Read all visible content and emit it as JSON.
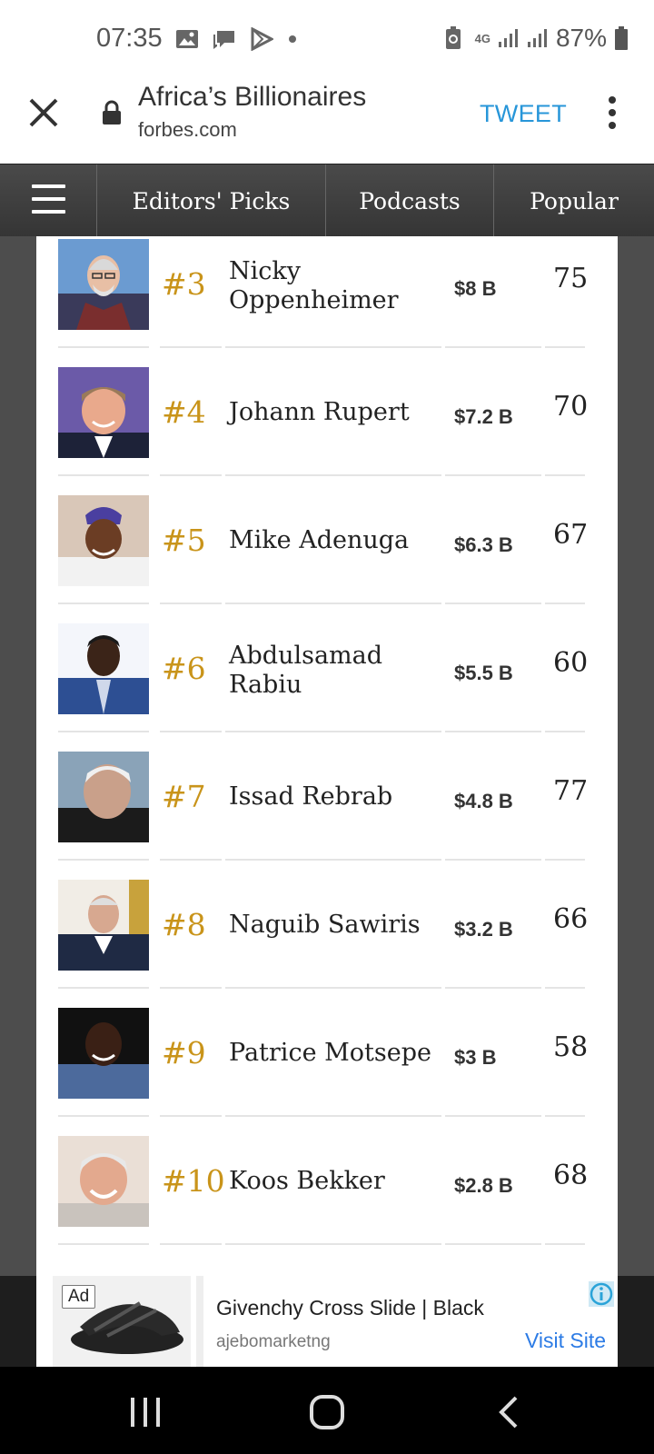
{
  "status_bar": {
    "time": "07:35",
    "network": "4G",
    "battery_percent": "87%",
    "left_icons": [
      "gallery-icon",
      "messages-icon",
      "play-store-icon",
      "dot-icon"
    ],
    "right_icons": [
      "battery-saver-icon",
      "network-4g-icon",
      "signal-icon",
      "signal-icon",
      "battery-icon"
    ]
  },
  "tab_header": {
    "title": "Africa’s Billionaires",
    "url": "forbes.com",
    "action_label": "TWEET"
  },
  "nav": {
    "items": [
      {
        "label": "Editors' Picks"
      },
      {
        "label": "Podcasts"
      },
      {
        "label": "Popular"
      }
    ]
  },
  "billionaires": [
    {
      "rank": "#3",
      "name": "Nicky Oppenheimer",
      "net_worth": "$8 B",
      "age": "75"
    },
    {
      "rank": "#4",
      "name": "Johann Rupert",
      "net_worth": "$7.2 B",
      "age": "70"
    },
    {
      "rank": "#5",
      "name": "Mike Adenuga",
      "net_worth": "$6.3 B",
      "age": "67"
    },
    {
      "rank": "#6",
      "name": "Abdulsamad Rabiu",
      "net_worth": "$5.5 B",
      "age": "60"
    },
    {
      "rank": "#7",
      "name": "Issad Rebrab",
      "net_worth": "$4.8 B",
      "age": "77"
    },
    {
      "rank": "#8",
      "name": "Naguib Sawiris",
      "net_worth": "$3.2 B",
      "age": "66"
    },
    {
      "rank": "#9",
      "name": "Patrice Motsepe",
      "net_worth": "$3 B",
      "age": "58"
    },
    {
      "rank": "#10",
      "name": "Koos Bekker",
      "net_worth": "$2.8 B",
      "age": "68"
    }
  ],
  "ad": {
    "tag": "Ad",
    "title": "Givenchy Cross Slide | Black",
    "advertiser": "ajebomarketng",
    "cta": "Visit Site"
  },
  "colors": {
    "rank_gold": "#c9941a",
    "tweet_blue": "#2796d9",
    "nav_bg": "#404040"
  }
}
